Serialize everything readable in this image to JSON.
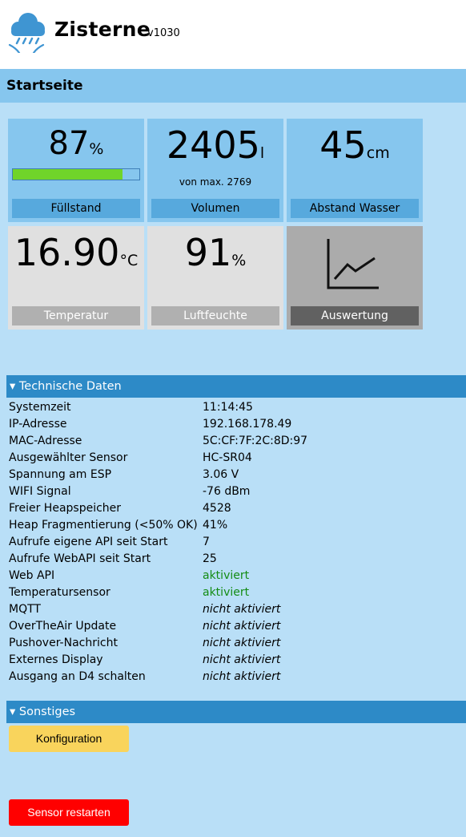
{
  "app": {
    "title": "Zisterne",
    "version": "v1030",
    "logo_icon": "cloud-rain-icon"
  },
  "page": {
    "title": "Startseite"
  },
  "tiles": {
    "fill": {
      "value": "87",
      "unit": "%",
      "label": "Füllstand",
      "level_percent": 87
    },
    "volume": {
      "value": "2405",
      "unit": "l",
      "note": "von max. 2769",
      "label": "Volumen"
    },
    "distance": {
      "value": "45",
      "unit": "cm",
      "label": "Abstand Wasser"
    },
    "temperature": {
      "value": "16.90",
      "unit": "°C",
      "label": "Temperatur"
    },
    "humidity": {
      "value": "91",
      "unit": "%",
      "label": "Luftfeuchte"
    },
    "analysis": {
      "label": "Auswertung",
      "icon": "line-chart-icon"
    }
  },
  "tech": {
    "header": "▾ Technische Daten",
    "rows": [
      {
        "key": "Systemzeit",
        "value": "11:14:45"
      },
      {
        "key": "IP-Adresse",
        "value": "192.168.178.49"
      },
      {
        "key": "MAC-Adresse",
        "value": "5C:CF:7F:2C:8D:97"
      },
      {
        "key": "Ausgewählter Sensor",
        "value": "HC-SR04"
      },
      {
        "key": "Spannung am ESP",
        "value": "3.06 V"
      },
      {
        "key": "WIFI Signal",
        "value": "-76 dBm"
      },
      {
        "key": "Freier Heapspeicher",
        "value": "4528"
      },
      {
        "key": "Heap Fragmentierung (<50% OK)",
        "value": "41%"
      },
      {
        "key": "Aufrufe eigene API seit Start",
        "value": "7"
      },
      {
        "key": "Aufrufe WebAPI seit Start",
        "value": "25"
      },
      {
        "key": "Web API",
        "value": "aktiviert"
      },
      {
        "key": "Temperatursensor",
        "value": "aktiviert"
      },
      {
        "key": "MQTT",
        "value": "nicht aktiviert"
      },
      {
        "key": "OverTheAir Update",
        "value": "nicht aktiviert"
      },
      {
        "key": "Pushover-Nachricht",
        "value": "nicht aktiviert"
      },
      {
        "key": "Externes Display",
        "value": "nicht aktiviert"
      },
      {
        "key": "Ausgang an D4 schalten",
        "value": "nicht aktiviert"
      }
    ]
  },
  "misc": {
    "header": "▾ Sonstiges",
    "config_button": "Konfiguration",
    "restart_button": "Sensor restarten"
  },
  "colors": {
    "active": "#148c14",
    "section": "#2d8ac7",
    "tile_blue": "#86c6ee",
    "progress": "#70d42a"
  }
}
